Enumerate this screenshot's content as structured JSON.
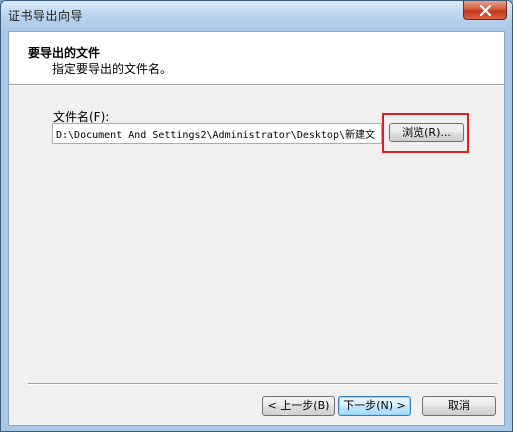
{
  "window": {
    "title": "证书导出向导"
  },
  "header": {
    "title": "要导出的文件",
    "subtitle": "指定要导出的文件名。"
  },
  "form": {
    "file_label": "文件名(F):",
    "file_value": "D:\\Document And Settings2\\Administrator\\Desktop\\新建文",
    "browse_label": "浏览(R)..."
  },
  "footer": {
    "back_label": "< 上一步(B)",
    "next_label": "下一步(N) >",
    "cancel_label": "取消"
  },
  "colors": {
    "highlight": "#e02020",
    "close_button": "#c2391a"
  }
}
